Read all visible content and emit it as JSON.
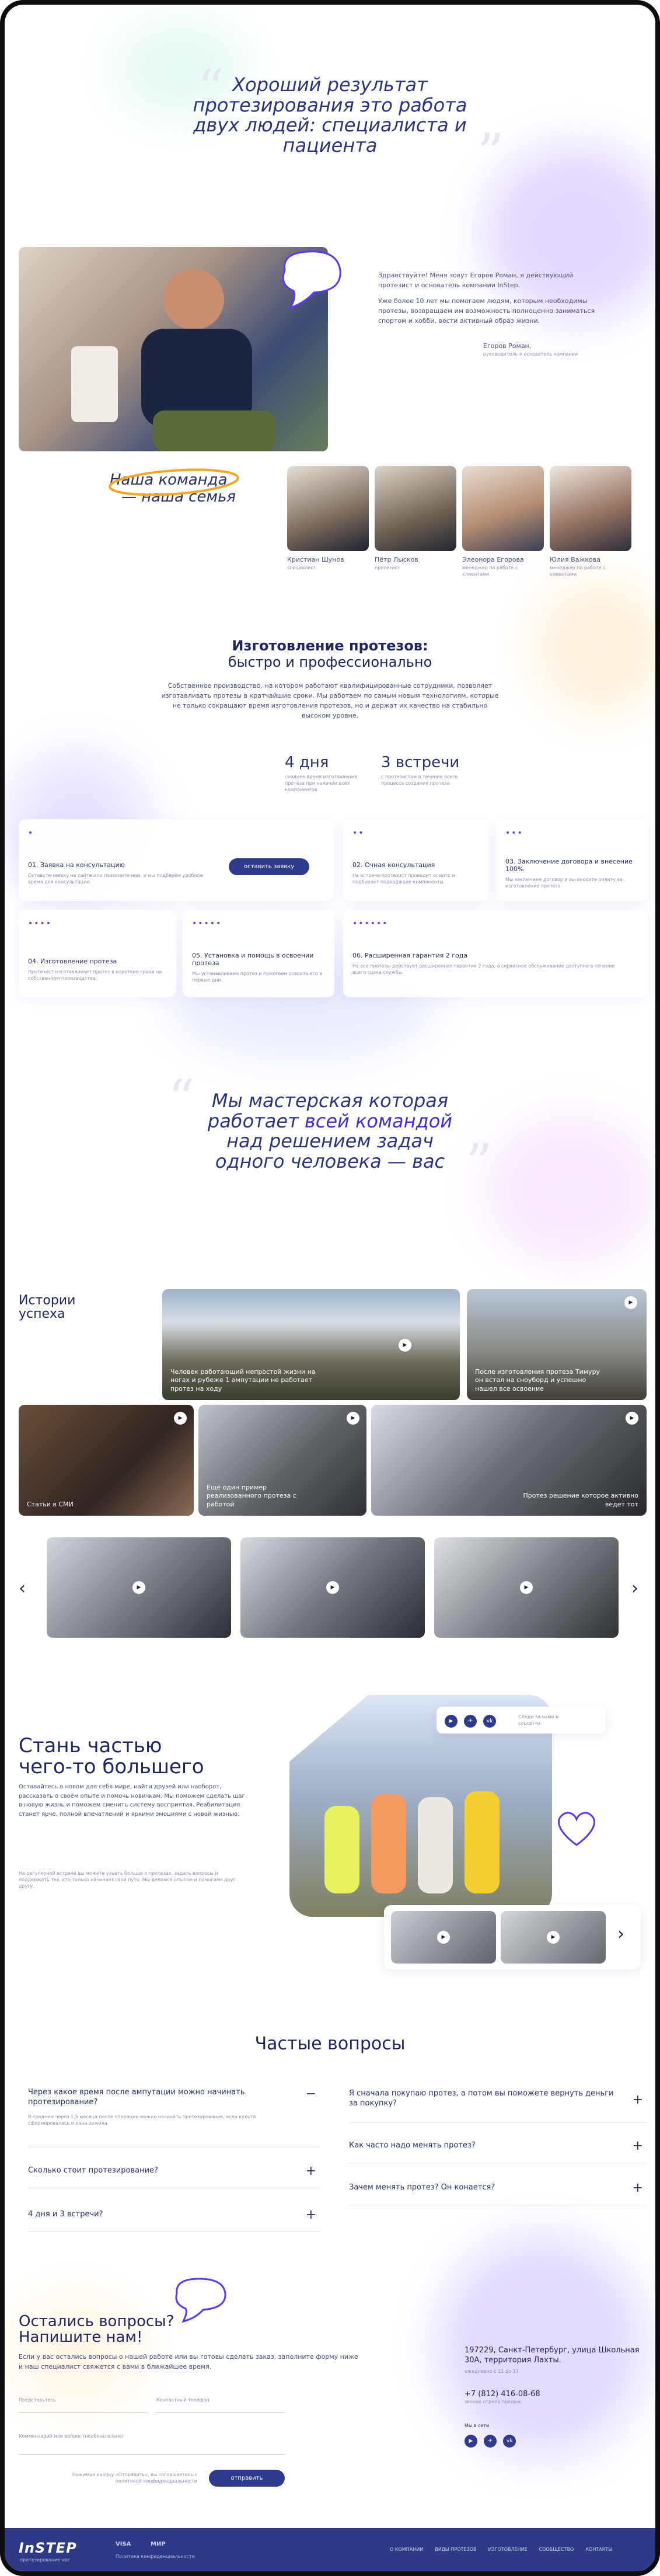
{
  "hero": {
    "title": "Хороший результат протезирования это работа двух людей: специалиста и пациента"
  },
  "founder": {
    "text1": "Здравствуйте! Меня зовут Егоров Роман, я действующий протезист и основатель компании InStep.",
    "text2": "Уже более 10 лет мы помогаем людям, которым необходимы протезы, возвращаем им возможность полноценно заниматься спортом и хобби, вести активный образ жизни.",
    "signature": "Егоров Роман,",
    "signature_role": "руководитель и основатель компании"
  },
  "team": {
    "title_line1": "Наша команда",
    "title_line2": "— наша семья",
    "members": [
      {
        "name": "Кристиан Шунов",
        "role": "специалист"
      },
      {
        "name": "Пётр Лысков",
        "role": "протезист"
      },
      {
        "name": "Элеонора Егорова",
        "role": "менеджер по работе с клиентами"
      },
      {
        "name": "Юлия Важкова",
        "role": "менеджер по работе с клиентами"
      }
    ]
  },
  "production": {
    "title_line1": "Изготовление протезов:",
    "title_line2": "быстро и профессионально",
    "text": "Собственное производство, на котором работают квалифицированные сотрудники, позволяет изготавливать протезы в кратчайшие сроки. Мы работаем по самым новым технологиям, которые не только сокращают время изготовления протезов, но и держат их качество на стабильно высоком уровне.",
    "stat1_value": "4 дня",
    "stat1_text": "среднее время изготовления протеза при наличии всех компонентов",
    "stat2_value": "3 встречи",
    "stat2_text": "с протезистом в течение всего процесса создания протеза",
    "btn": "оставить заявку",
    "steps": [
      {
        "dots": "•",
        "title": "01. Заявка на консультацию",
        "text": "Оставьте заявку на сайте или позвоните нам, и мы подберём удобное время для консультации."
      },
      {
        "dots": "••",
        "title": "02. Очная консультация",
        "text": "На встрече протезист проводит осмотр и подбирает подходящие компоненты."
      },
      {
        "dots": "•••",
        "title": "03. Заключение договора и внесение 100%",
        "text": "Мы заключаем договор и вы вносите оплату за изготовление протеза."
      },
      {
        "dots": "••••",
        "title": "04. Изготовление протеза",
        "text": "Протезист изготавливает протез в короткие сроки на собственном производстве."
      },
      {
        "dots": "•••••",
        "title": "05. Установка и помощь в освоении протеза",
        "text": "Мы устанавливаем протез и помогаем освоить его в первые дни."
      },
      {
        "dots": "••••••",
        "title": "06. Расширенная гарантия 2 года",
        "text": "На все протезы действует расширенная гарантия 2 года, а сервисное обслуживание доступно в течение всего срока службы."
      }
    ]
  },
  "workshop": {
    "title_plain1": "Мы мастерская которая",
    "title_plain2": "работает",
    "title_strong": "всей командой",
    "title_plain3": "над решением задач",
    "title_plain4": "одного человека — вас"
  },
  "stories": {
    "title": "Истории успеха",
    "tiles": [
      "Человек работающий непростой жизни на ногах и рубеже 1 ампутации не работает протез на ходу",
      "После изготовления протеза Тимуру он встал на сноуборд и успешно нашел все освоение",
      "Статьи в СМИ",
      "Ещё один пример реализованного протеза с работой",
      "Протез решение которое активно ведет тот"
    ],
    "prev": "‹",
    "next": "›"
  },
  "join": {
    "title_line1": "Стань частью",
    "title_line2": "чего-то большего",
    "text1": "Оставайтесь в новом для себя мире, найти друзей или наоборот, рассказать о своём опыте и помочь новичкам. Мы поможем сделать шаг в новую жизнь и поможем сменить систему восприятия. Реабилитация станет ярче, полной впечатлений и яркими эмоциями с новой жизнью.",
    "text2": "На регулярной встрече вы можете узнать больше о протезах, задать вопросы и поддержать тех, кто только начинает свой путь. Мы делимся опытом и помогаем друг другу.",
    "social_label": "Следи за нами в соцсетях",
    "socials": [
      "youtube-icon",
      "telegram-icon",
      "vk-icon"
    ]
  },
  "faq": {
    "title": "Частые вопросы",
    "left": [
      {
        "q": "Через какое время после ампутации можно начинать протезирование?",
        "a": "В среднем через 1,5 месяца после операции можно начинать протезирование, если культя сформировалась и рана зажила.",
        "open": true
      },
      {
        "q": "Сколько стоит протезирование?",
        "open": false
      },
      {
        "q": "4 дня и 3 встречи?",
        "open": false
      }
    ],
    "right": [
      {
        "q": "Я сначала покупаю протез, а потом вы поможете вернуть деньги за покупку?"
      },
      {
        "q": "Как часто надо менять протез?"
      },
      {
        "q": "Зачем менять протез? Он конается?"
      }
    ]
  },
  "contact": {
    "title_line1": "Остались вопросы?",
    "title_line2": "Напишите нам!",
    "text": "Если у вас остались вопросы о нашей работе или вы готовы сделать заказ, заполните форму ниже и наш специалист свяжется с вами в ближайшее время.",
    "field_name": "Представьтесь",
    "field_phone": "Контактный телефон",
    "field_comment": "Комментарий или вопрос (необязательно)",
    "consent": "Нажимая кнопку «Отправить», вы соглашаетесь с политикой конфиденциальности",
    "submit": "отправить",
    "address": "197229, Санкт-Петербург, улица Школьная 30А, территория Лахты.",
    "hours": "ежедневно с 11 до 17",
    "phone": "+7 (812) 416-08-68",
    "phone_note": "звонок отдела продаж",
    "socials_label": "Мы в сети"
  },
  "footer": {
    "logo": "InSTEP",
    "logo_sub": "протезирование ног",
    "pay1": "VISA",
    "pay2": "МИР",
    "policy": "Политика конфиденциальности",
    "nav": [
      "О КОМПАНИИ",
      "ВИДЫ ПРОТЕЗОВ",
      "ИЗГОТОВЛЕНИЕ",
      "СООБЩЕСТВО",
      "КОНТАКТЫ"
    ]
  }
}
